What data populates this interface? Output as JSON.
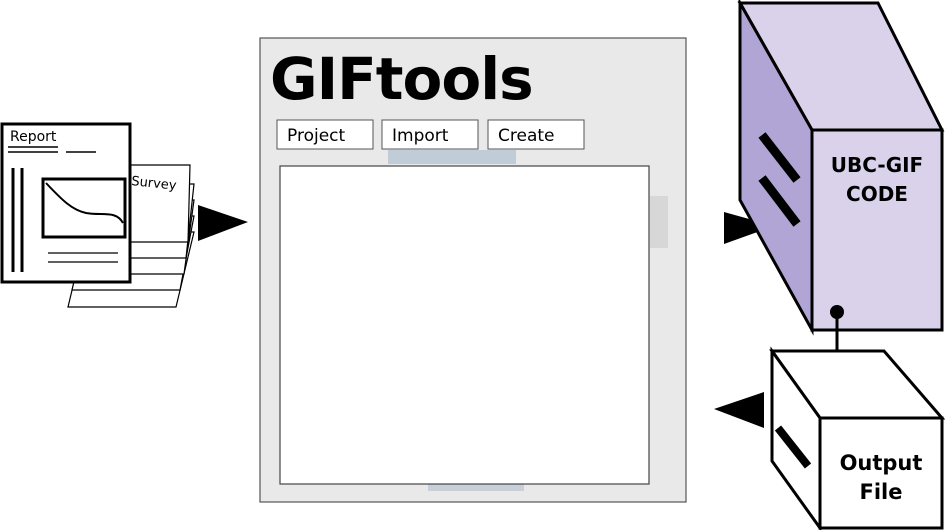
{
  "report": {
    "label": "Report"
  },
  "survey": {
    "label": "Survey"
  },
  "app": {
    "title": "GIFtools",
    "buttons": [
      "Project",
      "Import",
      "Create"
    ]
  },
  "code_box": {
    "line1": "UBC-GIF",
    "line2": "CODE"
  },
  "output_box": {
    "line1": "Output",
    "line2": "File"
  },
  "colors": {
    "panel_bg": "#e9e9e9",
    "box_front": "#dad2ea",
    "box_side": "#b1a5d5",
    "stroke": "#000000"
  }
}
